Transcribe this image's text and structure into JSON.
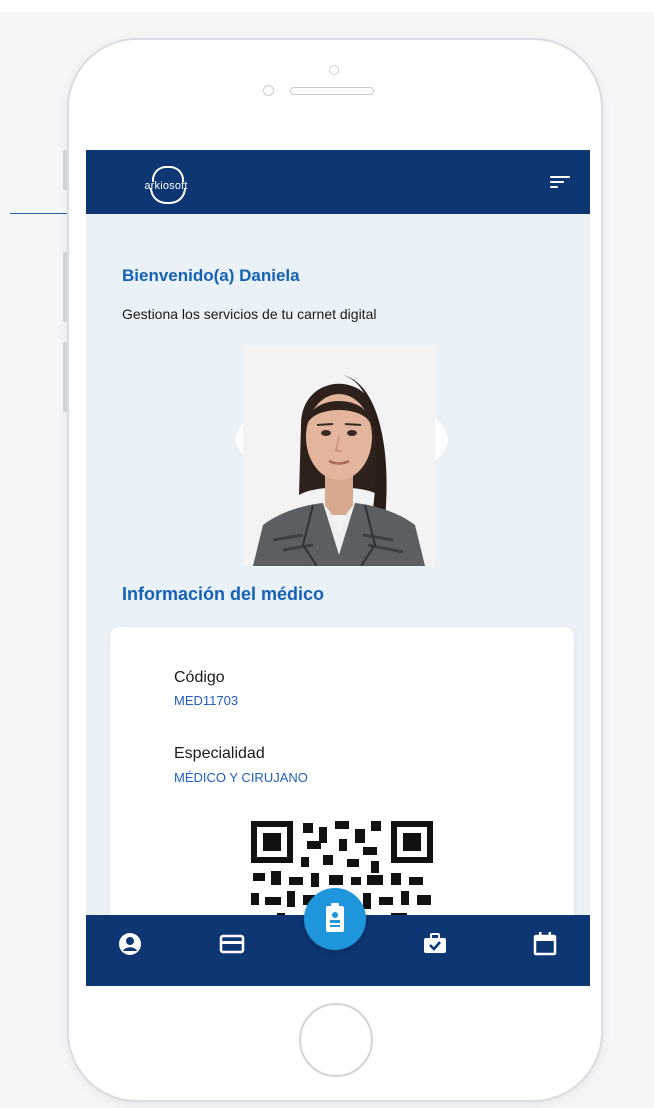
{
  "header": {
    "logo_text": "arkiosoft",
    "menu_icon": "menu-icon"
  },
  "welcome": {
    "title": "Bienvenido(a) Daniela",
    "subtitle": "Gestiona los servicios de tu carnet digital"
  },
  "doctor_info": {
    "section_title": "Información del médico",
    "fields": [
      {
        "label": "Código",
        "value": "MED11703"
      },
      {
        "label": "Especialidad",
        "value": "MÉDICO Y CIRUJANO"
      }
    ],
    "qr_icon": "qr-code"
  },
  "bottom_nav": {
    "items": [
      {
        "icon": "user-circle-icon",
        "active": false
      },
      {
        "icon": "credit-card-icon",
        "active": false
      },
      {
        "icon": "id-badge-icon",
        "active": true
      },
      {
        "icon": "briefcase-check-icon",
        "active": false
      },
      {
        "icon": "calendar-icon",
        "active": false
      }
    ]
  },
  "colors": {
    "primary": "#0d3673",
    "accent": "#1461b7",
    "center_button": "#1f95dc",
    "screen_bg": "#eaf1f7"
  }
}
